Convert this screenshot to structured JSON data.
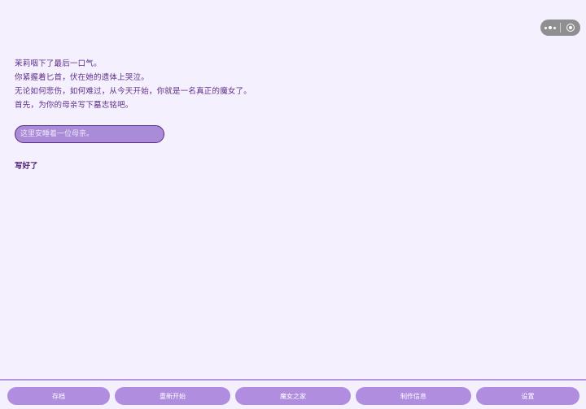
{
  "story": {
    "lines": [
      "茉莉咽下了最后一口气。",
      "你紧握着匕首，伏在她的遗体上哭泣。",
      "无论如何悲伤，如何难过，从今天开始，你就是一名真正的魔女了。",
      "首先，为你的母亲写下墓志铭吧。"
    ]
  },
  "epitaph": {
    "placeholder": "这里安睡着一位母亲。",
    "value": ""
  },
  "done_label": "写好了",
  "nav": {
    "save": "存档",
    "restart": "重新开始",
    "witch_home": "魔女之家",
    "credits": "制作信息",
    "settings": "设置"
  },
  "colors": {
    "background": "#f5f0fd",
    "text": "#5e2e8a",
    "button": "#b08ddf",
    "input_fill": "#a98bd8",
    "input_border": "#5b2a86"
  }
}
